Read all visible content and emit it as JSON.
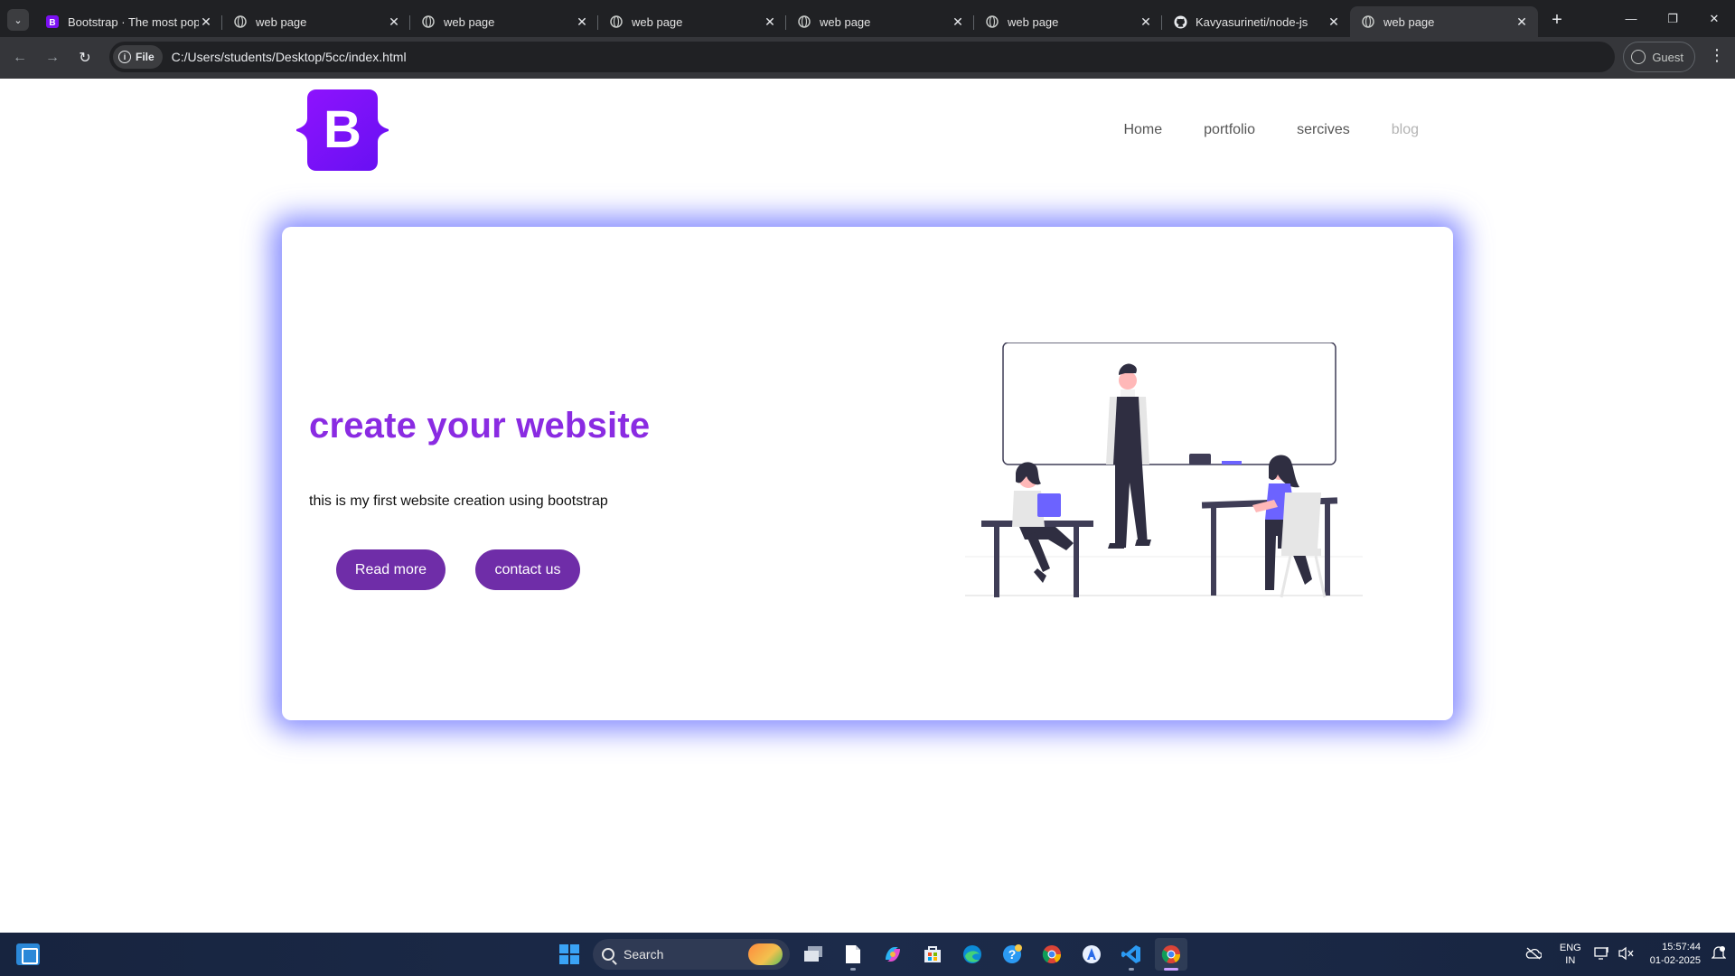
{
  "browser": {
    "tabs": [
      {
        "title": "Bootstrap · The most pop",
        "favicon": "bootstrap-favicon"
      },
      {
        "title": "web page",
        "favicon": "globe-icon"
      },
      {
        "title": "web page",
        "favicon": "globe-icon"
      },
      {
        "title": "web page",
        "favicon": "globe-icon"
      },
      {
        "title": "web page",
        "favicon": "globe-icon"
      },
      {
        "title": "web page",
        "favicon": "globe-icon"
      },
      {
        "title": "Kavyasurineti/node-js",
        "favicon": "github-icon"
      },
      {
        "title": "web page",
        "favicon": "globe-icon",
        "active": true
      }
    ],
    "chip_label": "File",
    "url": "C:/Users/students/Desktop/5cc/index.html",
    "profile_label": "Guest"
  },
  "site": {
    "logo_letter": "B",
    "nav": [
      "Home",
      "portfolio",
      "sercives",
      "blog"
    ],
    "hero": {
      "title": "create your website",
      "text": "this is my first website creation using bootstrap",
      "read_more": "Read more",
      "contact": "contact us"
    },
    "colors": {
      "brand": "#8a2be2",
      "button": "#6f2da8",
      "glow": "#626aff",
      "logo": "#7b10f2"
    }
  },
  "taskbar": {
    "search_placeholder": "Search",
    "lang_top": "ENG",
    "lang_bottom": "IN",
    "time": "15:57:44",
    "date": "01-02-2025"
  }
}
